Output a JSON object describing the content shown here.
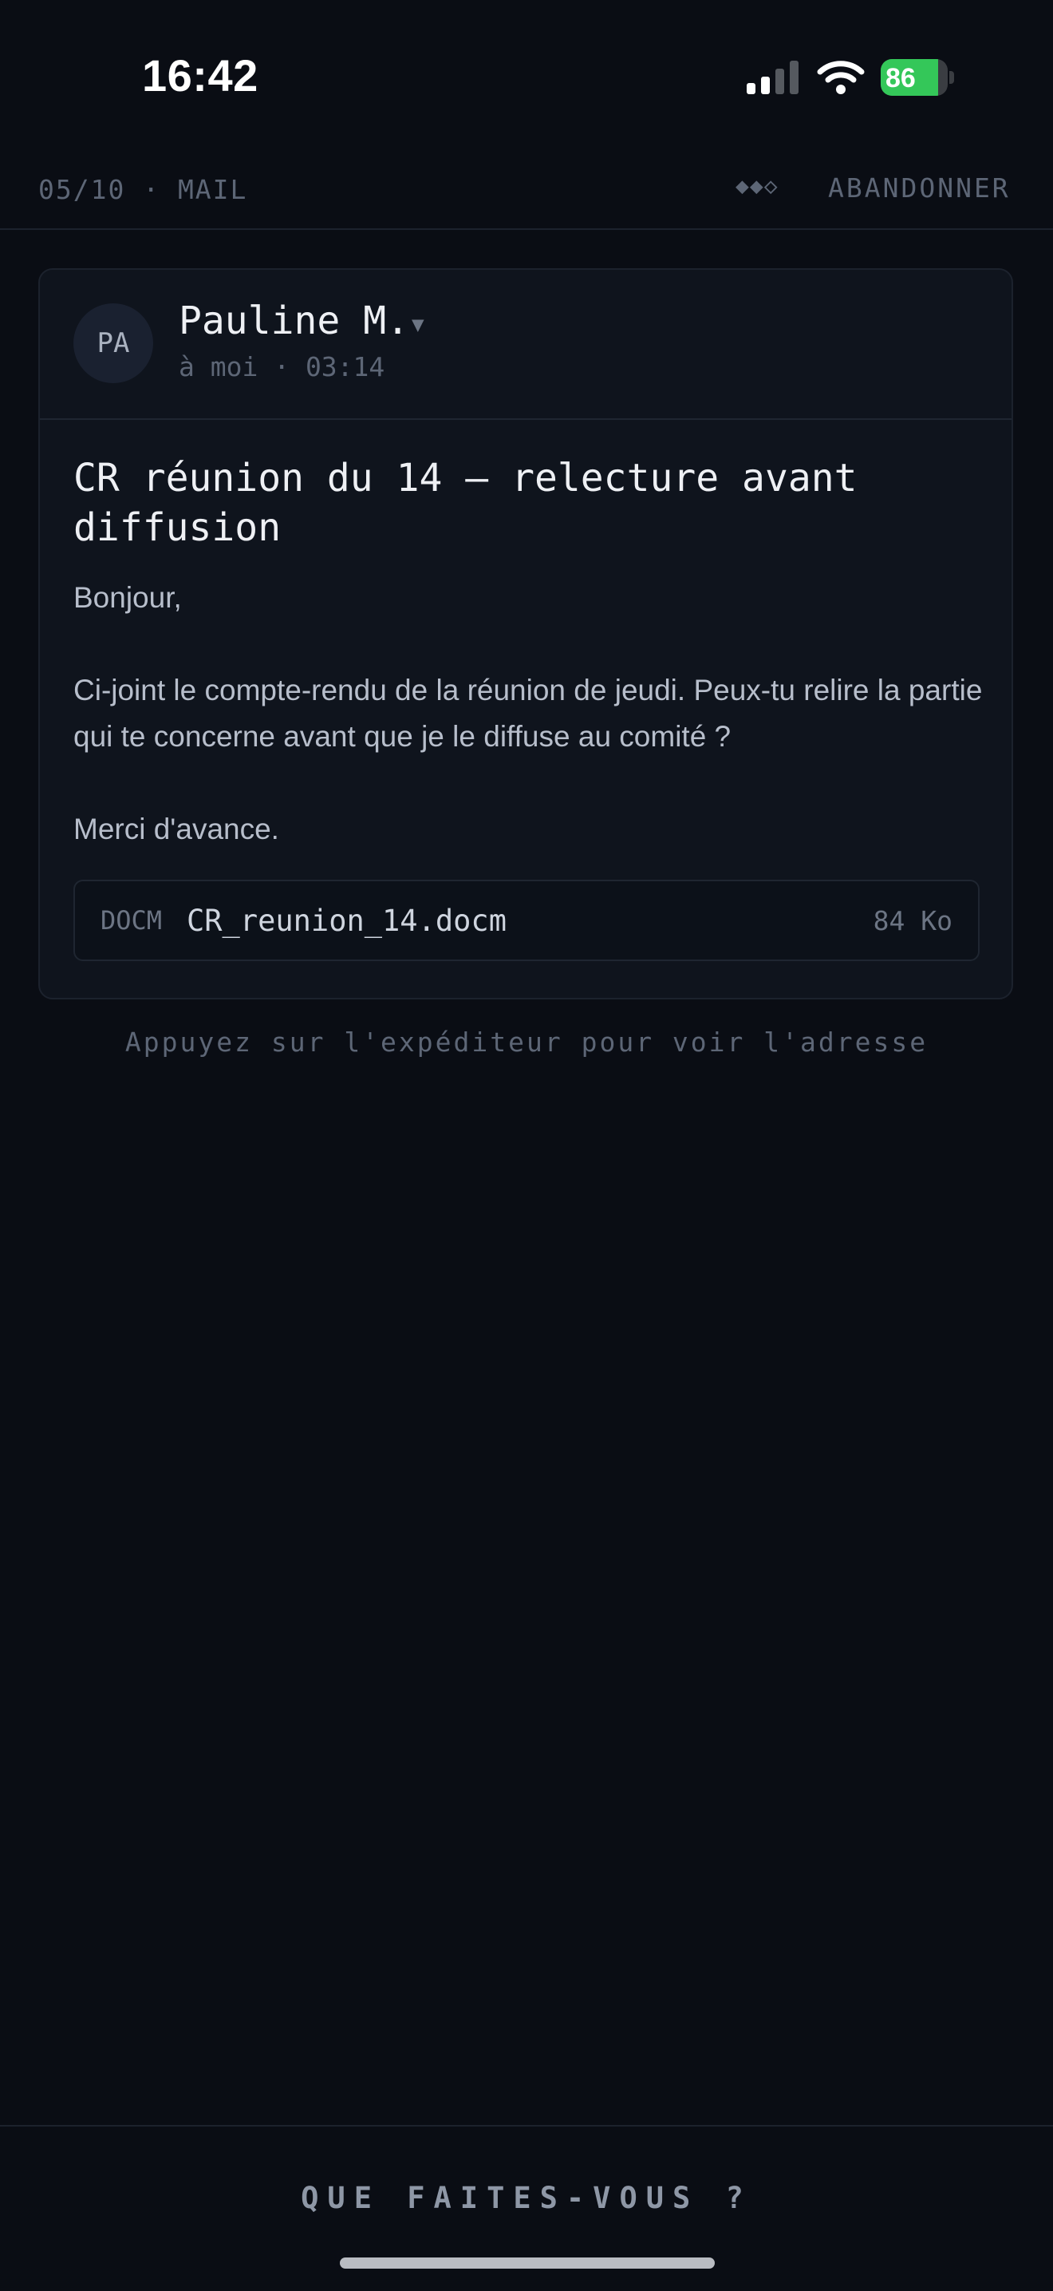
{
  "status_bar": {
    "time": "16:42",
    "battery_level": "86",
    "battery_fraction": 0.86,
    "icons": [
      "signal-icon",
      "wifi-icon",
      "battery-charging-icon"
    ]
  },
  "header": {
    "progress": "05/10 · MAIL",
    "difficulty": "◆◆◇",
    "abandon_label": "ABANDONNER"
  },
  "mail": {
    "avatar_initials": "PA",
    "sender_name": "Pauline M.",
    "sender_caret": "▼",
    "meta": "à moi · 03:14",
    "subject": "CR réunion du 14 — relecture avant diffusion",
    "greeting": "Bonjour,",
    "body": "Ci-joint le compte-rendu de la réunion de jeudi. Peux-tu relire la partie qui te concerne avant que je le diffuse au comité ?",
    "signoff": "Merci d'avance.",
    "attachment": {
      "type": "DOCM",
      "name": "CR_reunion_14.docm",
      "size": "84 Ko"
    }
  },
  "hint": "Appuyez sur l'expéditeur pour voir l'adresse",
  "prompt": "QUE FAITES-VOUS ?",
  "colors": {
    "background": "#0a0d14",
    "card": "#0f141d",
    "battery_green": "#34c759"
  }
}
